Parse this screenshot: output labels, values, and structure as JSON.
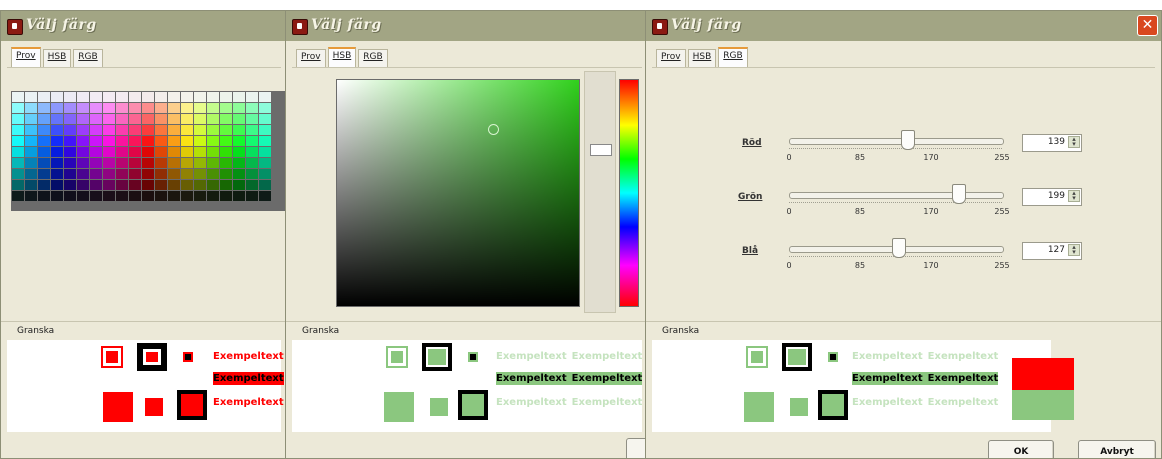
{
  "dialog_title": "Välj färg",
  "tabs": [
    "Prov",
    "HSB",
    "RGB"
  ],
  "preview_label": "Granska",
  "sample_text": "Exempeltext",
  "rgb": {
    "red": {
      "label": "Röd",
      "value": "139"
    },
    "green": {
      "label": "Grön",
      "value": "199"
    },
    "blue": {
      "label": "Blå",
      "value": "127"
    },
    "ticks": [
      "0",
      "85",
      "170",
      "255"
    ]
  },
  "buttons": {
    "ok": "OK",
    "cancel": "Avbryt"
  },
  "colors": {
    "chosen_red": "#ff0000",
    "chosen_green": "#8bc77f",
    "xp_title": "#a2a584",
    "xp_face": "#ece9d8"
  }
}
